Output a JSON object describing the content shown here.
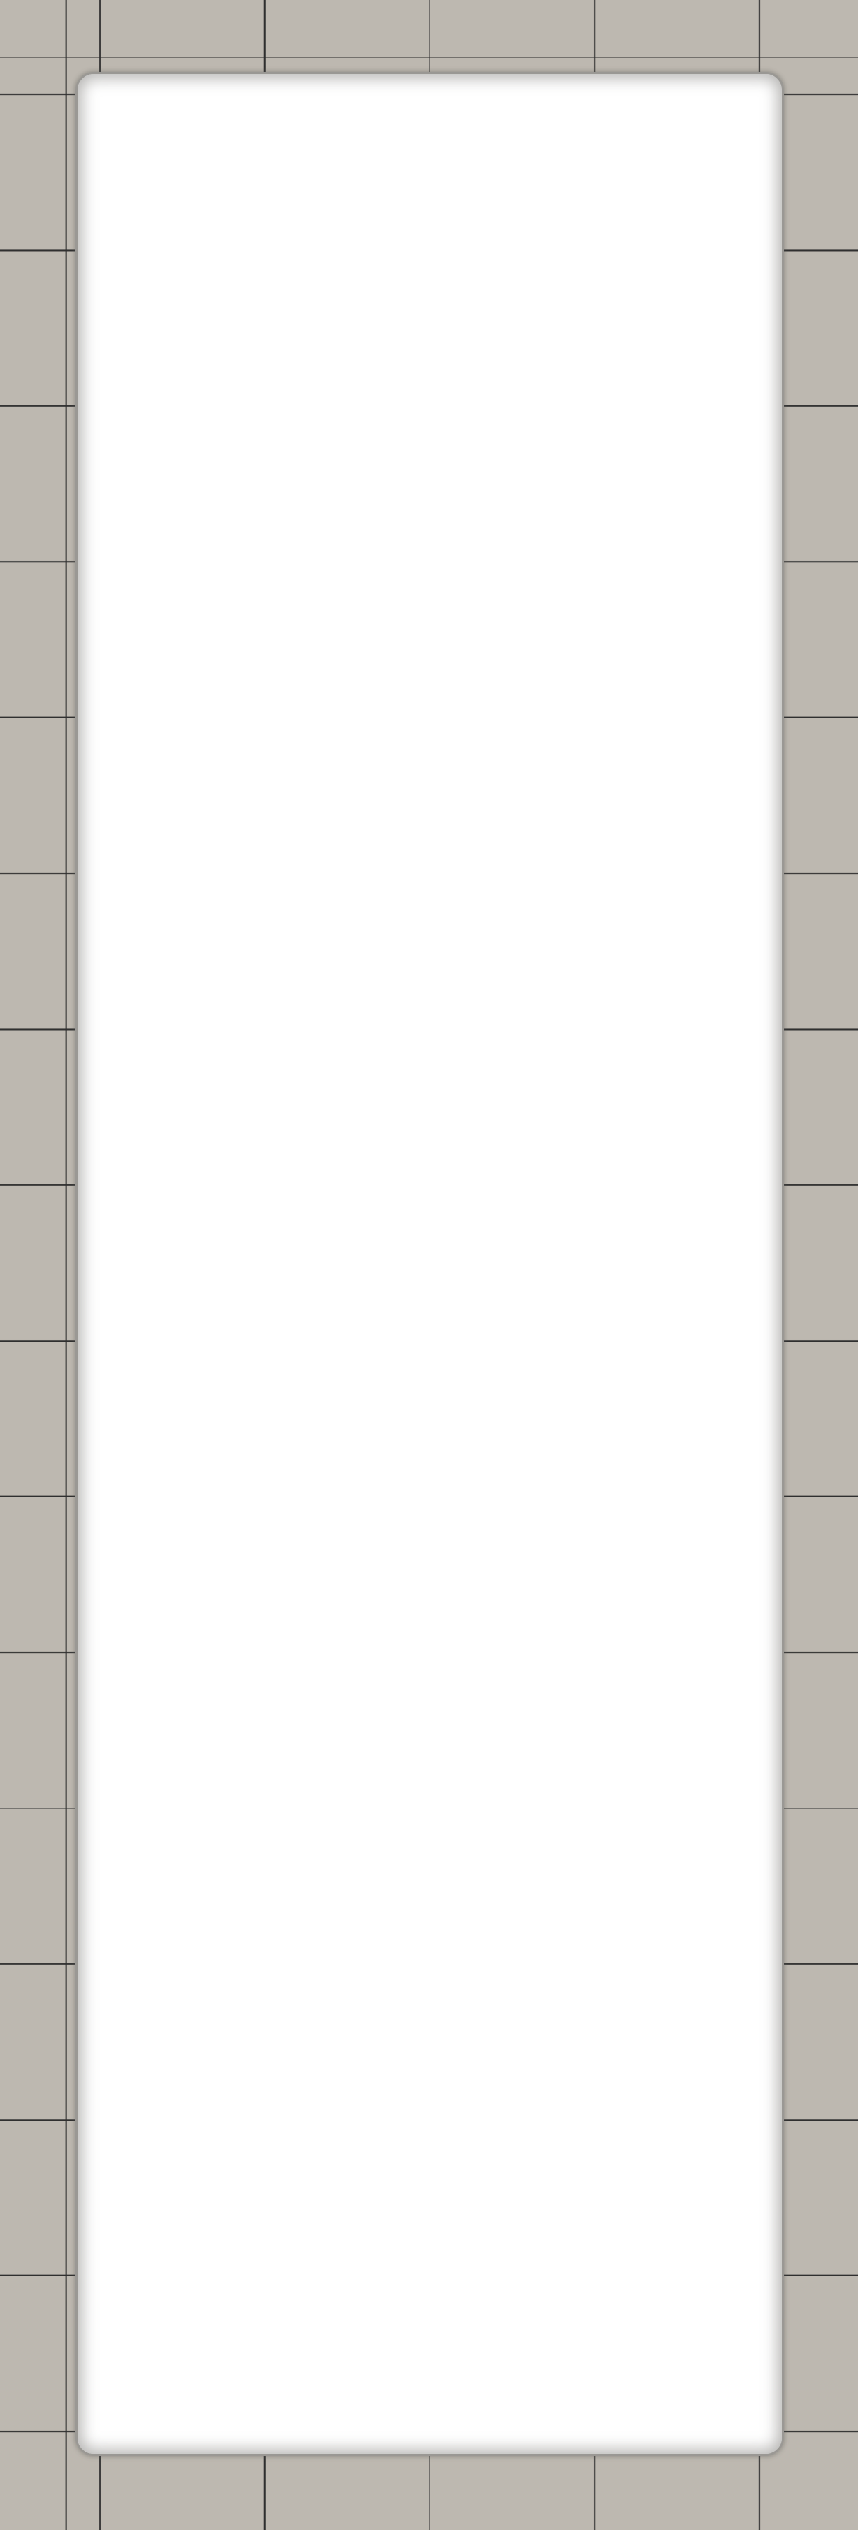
{
  "background": {
    "tile_color": "#bdb8b0",
    "grout_color": "#2f2f2f"
  },
  "panel": {
    "fill_color": "#ffffff",
    "border_color": "#9a9894",
    "content": []
  }
}
